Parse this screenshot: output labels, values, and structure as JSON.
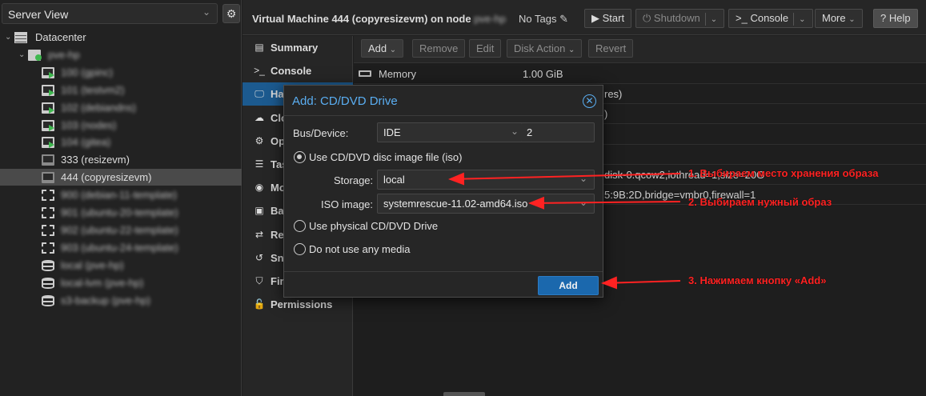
{
  "left_panel": {
    "view_label": "Server View",
    "tree": [
      {
        "label": "Datacenter",
        "type": "datacenter",
        "blurred": false
      },
      {
        "label": "pve-hp",
        "type": "node",
        "blurred": true
      },
      {
        "label": "100 (gpinc)",
        "type": "vm-running",
        "blurred": true
      },
      {
        "label": "101 (testvm2)",
        "type": "vm-running",
        "blurred": true
      },
      {
        "label": "102 (debiandns)",
        "type": "vm-running",
        "blurred": true
      },
      {
        "label": "103 (nodes)",
        "type": "vm-running",
        "blurred": true
      },
      {
        "label": "104 (gitea)",
        "type": "vm-running",
        "blurred": true
      },
      {
        "label": "333 (resizevm)",
        "type": "vm-stopped",
        "blurred": false
      },
      {
        "label": "444 (copyresizevm)",
        "type": "vm-stopped",
        "blurred": false,
        "selected": true
      },
      {
        "label": "900 (debian-11-template)",
        "type": "template",
        "blurred": true
      },
      {
        "label": "901 (ubuntu-20-template)",
        "type": "template",
        "blurred": true
      },
      {
        "label": "902 (ubuntu-22-template)",
        "type": "template",
        "blurred": true
      },
      {
        "label": "903 (ubuntu-24-template)",
        "type": "template",
        "blurred": true
      },
      {
        "label": "local (pve-hp)",
        "type": "storage",
        "blurred": true
      },
      {
        "label": "local-lvm (pve-hp)",
        "type": "storage",
        "blurred": true
      },
      {
        "label": "s3-backup (pve-hp)",
        "type": "storage",
        "blurred": true
      }
    ]
  },
  "header": {
    "title": "Virtual Machine 444 (copyresizevm) on node",
    "node_blurred": "pve-hp",
    "tags_label": "No Tags",
    "buttons": {
      "start": "Start",
      "shutdown": "Shutdown",
      "console": "Console",
      "more": "More",
      "help": "Help"
    }
  },
  "vm_nav": [
    {
      "label": "Summary",
      "icon": "summary-icon",
      "glyph": "▤"
    },
    {
      "label": "Console",
      "icon": "console-icon",
      "glyph": ">_"
    },
    {
      "label": "Hardware",
      "icon": "monitor-icon",
      "glyph": "🖵",
      "active": true
    },
    {
      "label": "Cloud-Init",
      "icon": "cloud-icon",
      "glyph": "☁"
    },
    {
      "label": "Options",
      "icon": "gear-icon",
      "glyph": "⚙"
    },
    {
      "label": "Task History",
      "icon": "list-icon",
      "glyph": "☰"
    },
    {
      "label": "Monitor",
      "icon": "eye-icon",
      "glyph": "◉"
    },
    {
      "label": "Backup",
      "icon": "floppy-icon",
      "glyph": "▣"
    },
    {
      "label": "Replication",
      "icon": "retweet-icon",
      "glyph": "⇄"
    },
    {
      "label": "Snapshots",
      "icon": "history-icon",
      "glyph": "↺"
    },
    {
      "label": "Firewall",
      "icon": "shield-icon",
      "glyph": "⛉"
    },
    {
      "label": "Permissions",
      "icon": "unlock-icon",
      "glyph": "🔓"
    }
  ],
  "hw_toolbar": {
    "add": "Add",
    "remove": "Remove",
    "edit": "Edit",
    "disk_action": "Disk Action",
    "revert": "Revert"
  },
  "hw_rows": [
    {
      "key": "Memory",
      "value": "1.00 GiB",
      "tail": ""
    },
    {
      "key": "",
      "value": "",
      "tail": "res)"
    },
    {
      "key": "",
      "value": "",
      "tail": ")"
    },
    {
      "key": "",
      "value": "",
      "tail": ""
    },
    {
      "key": "",
      "value": "",
      "tail": ""
    },
    {
      "key": "",
      "value": "",
      "tail": "disk-0.qcow2,iothread=1,size=20G"
    },
    {
      "key": "",
      "value": "",
      "tail": "5:9B:2D,bridge=vmbr0,firewall=1"
    }
  ],
  "modal": {
    "title": "Add: CD/DVD Drive",
    "bus_label": "Bus/Device:",
    "bus_value": "IDE",
    "device_value": "2",
    "option_iso": "Use CD/DVD disc image file (iso)",
    "storage_label": "Storage:",
    "storage_value": "local",
    "iso_label": "ISO image:",
    "iso_value": "systemrescue-11.02-amd64.iso",
    "option_physical": "Use physical CD/DVD Drive",
    "option_none": "Do not use any media",
    "add_button": "Add"
  },
  "annotations": {
    "a1": "1. Выбираем место хранения образа",
    "a2": "2. Выбираем нужный образ",
    "a3": "3. Нажимаем кнопку «Add»",
    "color": "#ff2222"
  },
  "colors": {
    "accent": "#1b68ad",
    "modal_title": "#5aaef2",
    "running": "#3fb84f"
  }
}
